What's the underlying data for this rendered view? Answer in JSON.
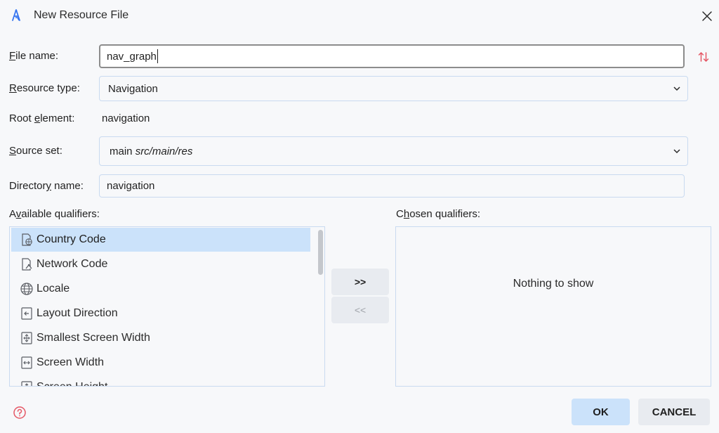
{
  "window": {
    "title": "New Resource File",
    "logo_icon": "android-studio-logo-icon",
    "close_icon": "close-icon"
  },
  "form": {
    "file_name": {
      "label_pre": "",
      "label_mnemonic": "F",
      "label_post": "ile name:",
      "value": "nav_graph"
    },
    "resource_type": {
      "label_pre": "",
      "label_mnemonic": "R",
      "label_post": "esource type:",
      "value": "Navigation"
    },
    "root_element": {
      "label_pre": "Root ",
      "label_mnemonic": "e",
      "label_post": "lement:",
      "value": "navigation"
    },
    "source_set": {
      "label_pre": "",
      "label_mnemonic": "S",
      "label_post": "ource set:",
      "value_main": "main",
      "value_path": "src/main/res"
    },
    "directory_name": {
      "label_pre": "Director",
      "label_mnemonic": "y",
      "label_post": " name:",
      "value": "navigation"
    }
  },
  "qualifiers": {
    "available_label_pre": "A",
    "available_label_mnemonic": "v",
    "available_label_post": "ailable qualifiers:",
    "chosen_label_pre": "C",
    "chosen_label_mnemonic": "h",
    "chosen_label_post": "osen qualifiers:",
    "available": [
      {
        "label": "Country Code",
        "icon": "country-code-icon",
        "selected": true
      },
      {
        "label": "Network Code",
        "icon": "network-code-icon",
        "selected": false
      },
      {
        "label": "Locale",
        "icon": "globe-icon",
        "selected": false
      },
      {
        "label": "Layout Direction",
        "icon": "layout-direction-icon",
        "selected": false
      },
      {
        "label": "Smallest Screen Width",
        "icon": "smallest-width-icon",
        "selected": false
      },
      {
        "label": "Screen Width",
        "icon": "screen-width-icon",
        "selected": false
      },
      {
        "label": "Screen Height",
        "icon": "screen-height-icon",
        "selected": false
      }
    ],
    "add_button": ">>",
    "remove_button": "<<",
    "chosen_empty_text": "Nothing to show"
  },
  "footer": {
    "ok": "OK",
    "cancel": "CANCEL",
    "help_icon": "help-icon"
  },
  "colors": {
    "accent": "#3574f0",
    "selection": "#cbe2fa",
    "field_border": "#c9daf0",
    "help_red": "#e55765"
  }
}
